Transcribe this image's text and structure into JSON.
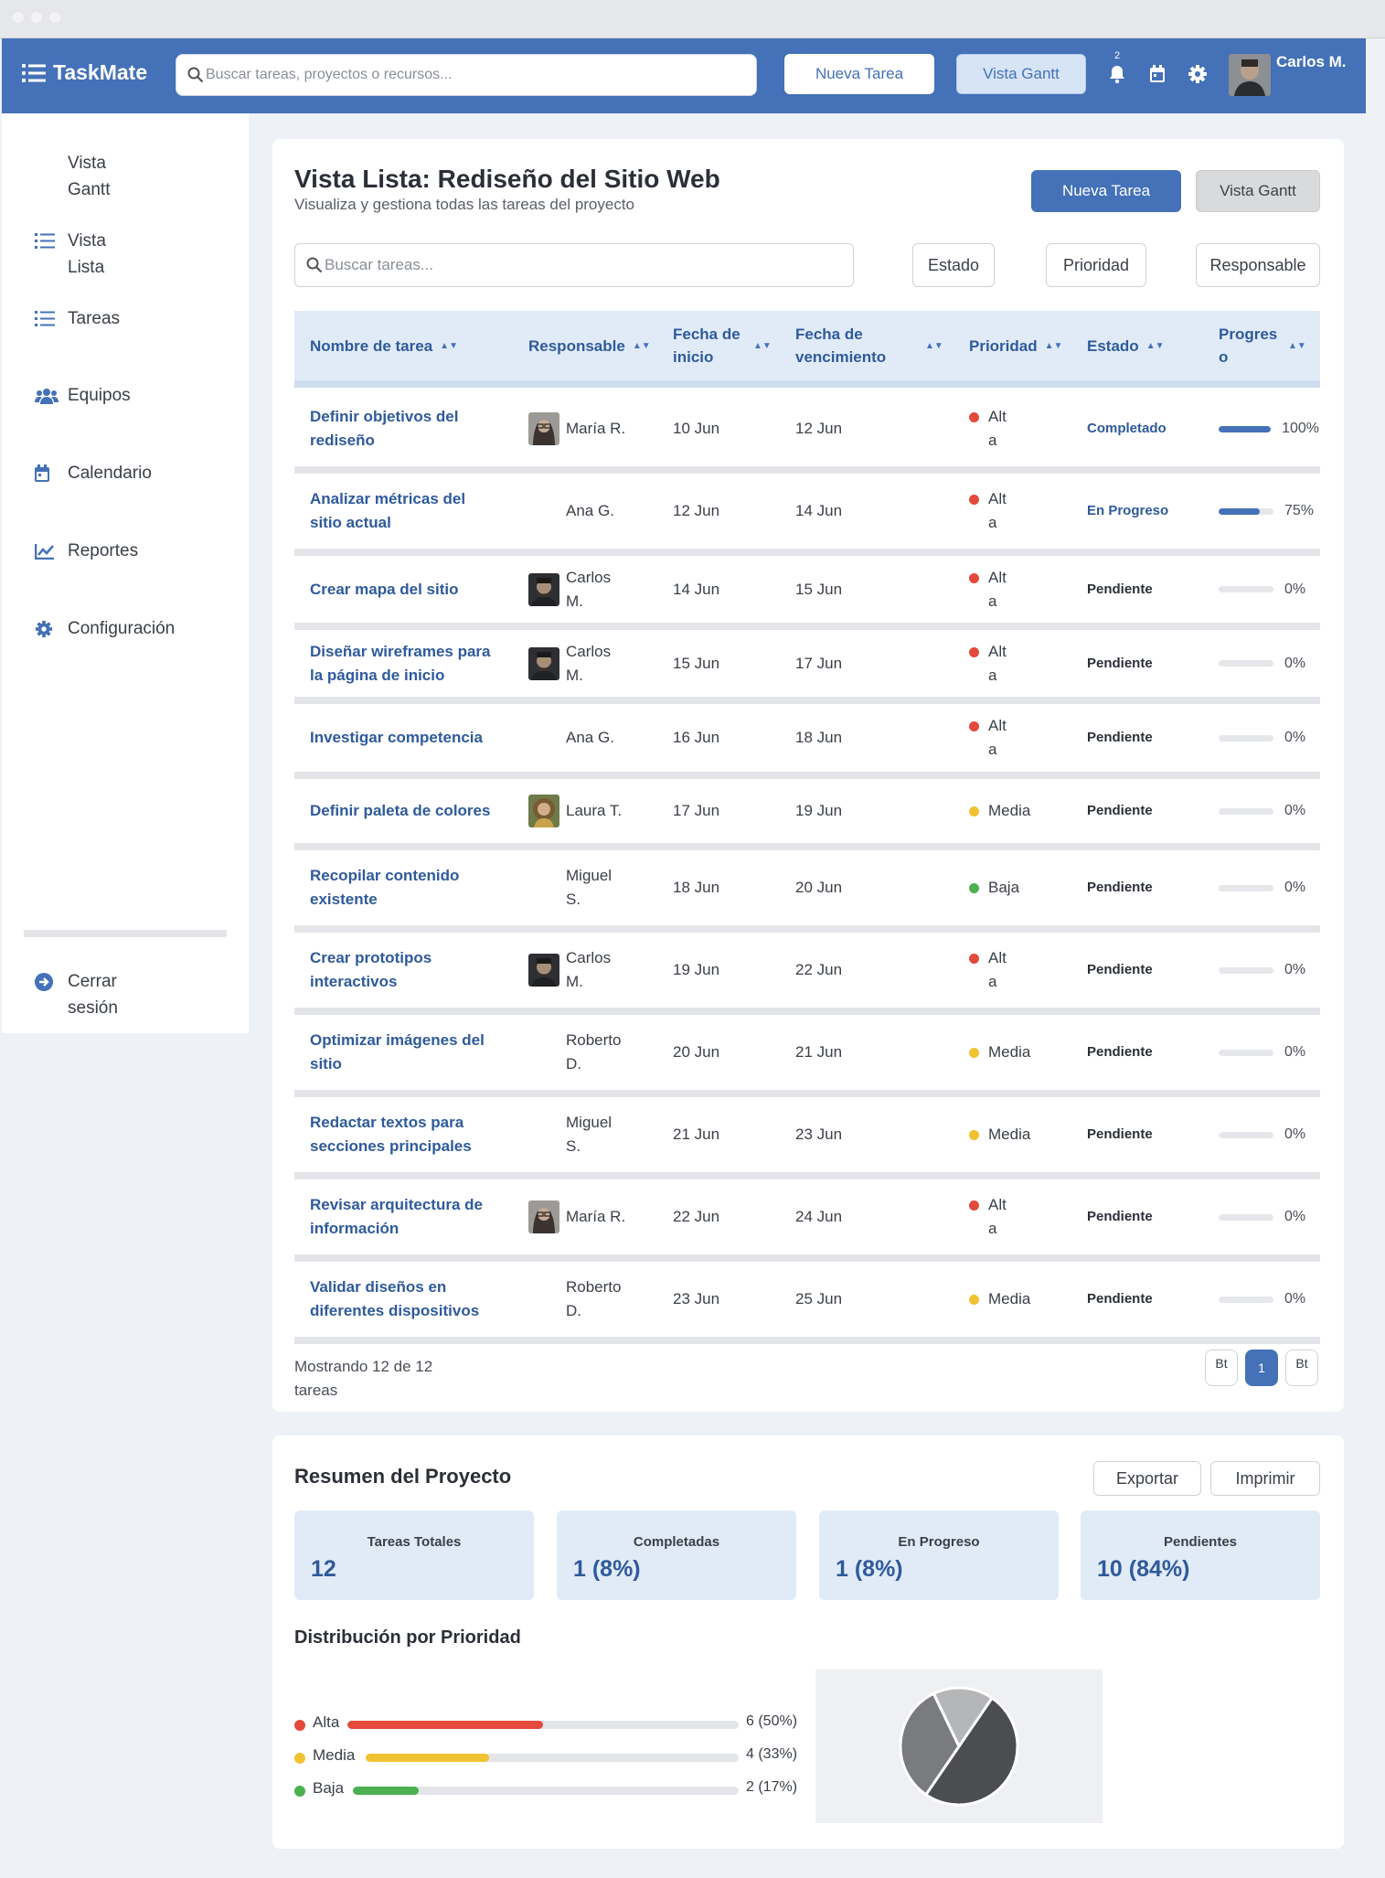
{
  "app": {
    "logo_text": "TaskMate",
    "search_placeholder": "Buscar tareas, proyectos o recursos...",
    "new_task_label": "Nueva Tarea",
    "gantt_label": "Vista Gantt",
    "notification_count": "2",
    "user_name": "Carlos M."
  },
  "sidebar": {
    "items": [
      {
        "label": "Vista Gantt",
        "icon": "gantt-icon"
      },
      {
        "label": "Vista Lista",
        "icon": "list-icon"
      },
      {
        "label": "Tareas",
        "icon": "list-icon"
      },
      {
        "label": "Equipos",
        "icon": "users-icon"
      },
      {
        "label": "Calendario",
        "icon": "calendar-icon"
      },
      {
        "label": "Reportes",
        "icon": "chart-line-icon"
      },
      {
        "label": "Configuración",
        "icon": "gear-icon"
      }
    ],
    "logout_label": "Cerrar sesión"
  },
  "list": {
    "title": "Vista Lista: Rediseño del Sitio Web",
    "subtitle": "Visualiza y gestiona todas las tareas del proyecto",
    "new_task_label": "Nueva Tarea",
    "gantt_label": "Vista Gantt",
    "search_placeholder": "Buscar tareas...",
    "filters": {
      "estado": "Estado",
      "prioridad": "Prioridad",
      "responsable": "Responsable"
    },
    "columns": {
      "name": "Nombre de tarea",
      "owner": "Responsable",
      "start": "Fecha de inicio",
      "due": "Fecha de vencimiento",
      "priority": "Prioridad",
      "status": "Estado",
      "progress": "Progreso"
    },
    "priority_colors": {
      "Alta": "#e34a3b",
      "Media": "#f1c232",
      "Baja": "#4caf50"
    },
    "rows": [
      {
        "name": "Definir objetivos del rediseño",
        "owner": "María R.",
        "avatar": "woman-glasses",
        "start": "10 Jun",
        "due": "12 Jun",
        "priority": "Alta",
        "status": "Completado",
        "progress": 100,
        "progress_text": "100%"
      },
      {
        "name": "Analizar métricas del sitio actual",
        "owner": "Ana G.",
        "avatar": "",
        "start": "12 Jun",
        "due": "14 Jun",
        "priority": "Alta",
        "status": "En Progreso",
        "progress": 75,
        "progress_text": "75%"
      },
      {
        "name": "Crear mapa del sitio",
        "owner": "Carlos M.",
        "avatar": "man-beard",
        "start": "14 Jun",
        "due": "15 Jun",
        "priority": "Alta",
        "status": "Pendiente",
        "progress": 0,
        "progress_text": "0%"
      },
      {
        "name": "Diseñar wireframes para la página de inicio",
        "owner": "Carlos M.",
        "avatar": "man-beard",
        "start": "15 Jun",
        "due": "17 Jun",
        "priority": "Alta",
        "status": "Pendiente",
        "progress": 0,
        "progress_text": "0%"
      },
      {
        "name": "Investigar competencia",
        "owner": "Ana G.",
        "avatar": "",
        "start": "16 Jun",
        "due": "18 Jun",
        "priority": "Alta",
        "status": "Pendiente",
        "progress": 0,
        "progress_text": "0%"
      },
      {
        "name": "Definir paleta de colores",
        "owner": "Laura T.",
        "avatar": "woman-curly",
        "start": "17 Jun",
        "due": "19 Jun",
        "priority": "Media",
        "status": "Pendiente",
        "progress": 0,
        "progress_text": "0%"
      },
      {
        "name": "Recopilar contenido existente",
        "owner": "Miguel S.",
        "avatar": "",
        "start": "18 Jun",
        "due": "20 Jun",
        "priority": "Baja",
        "status": "Pendiente",
        "progress": 0,
        "progress_text": "0%"
      },
      {
        "name": "Crear prototipos interactivos",
        "owner": "Carlos M.",
        "avatar": "man-beard",
        "start": "19 Jun",
        "due": "22 Jun",
        "priority": "Alta",
        "status": "Pendiente",
        "progress": 0,
        "progress_text": "0%"
      },
      {
        "name": "Optimizar imágenes del sitio",
        "owner": "Roberto D.",
        "avatar": "",
        "start": "20 Jun",
        "due": "21 Jun",
        "priority": "Media",
        "status": "Pendiente",
        "progress": 0,
        "progress_text": "0%"
      },
      {
        "name": "Redactar textos para secciones principales",
        "owner": "Miguel S.",
        "avatar": "",
        "start": "21 Jun",
        "due": "23 Jun",
        "priority": "Media",
        "status": "Pendiente",
        "progress": 0,
        "progress_text": "0%"
      },
      {
        "name": "Revisar arquitectura de información",
        "owner": "María R.",
        "avatar": "woman-glasses",
        "start": "22 Jun",
        "due": "24 Jun",
        "priority": "Alta",
        "status": "Pendiente",
        "progress": 0,
        "progress_text": "0%"
      },
      {
        "name": "Validar diseños en diferentes dispositivos",
        "owner": "Roberto D.",
        "avatar": "",
        "start": "23 Jun",
        "due": "25 Jun",
        "priority": "Media",
        "status": "Pendiente",
        "progress": 0,
        "progress_text": "0%"
      }
    ],
    "footer_text": "Mostrando 12 de 12 tareas",
    "pagination": {
      "prev": "Bt",
      "current": "1",
      "next": "Bt"
    }
  },
  "summary": {
    "title": "Resumen del Proyecto",
    "export_label": "Exportar",
    "print_label": "Imprimir",
    "stats": [
      {
        "label": "Tareas Totales",
        "value": "12"
      },
      {
        "label": "Completadas",
        "value": "1 (8%)"
      },
      {
        "label": "En Progreso",
        "value": "1 (8%)"
      },
      {
        "label": "Pendientes",
        "value": "10 (84%)"
      }
    ],
    "dist_title": "Distribución por Prioridad",
    "priorities": [
      {
        "label": "Alta",
        "value_text": "6 (50%)",
        "fraction": 0.5,
        "color": "#e34a3b"
      },
      {
        "label": "Media",
        "value_text": "4 (33%)",
        "fraction": 0.33,
        "color": "#f1c232"
      },
      {
        "label": "Baja",
        "value_text": "2 (17%)",
        "fraction": 0.17,
        "color": "#4caf50"
      }
    ]
  },
  "chart_data": {
    "type": "pie",
    "categories": [
      "Alta",
      "Media",
      "Baja"
    ],
    "values": [
      6,
      4,
      2
    ],
    "colors": [
      "#4b4d51",
      "#7a7b7e",
      "#b5b6b8"
    ]
  },
  "colors": {
    "accent": "#4471b8",
    "accent_light": "#e1ebf7"
  }
}
